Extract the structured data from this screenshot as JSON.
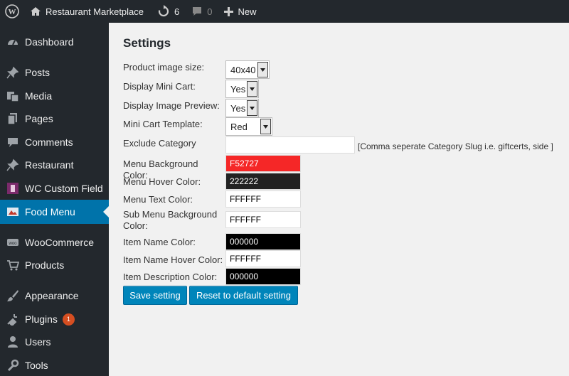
{
  "adminbar": {
    "site_name": "Restaurant Marketplace",
    "updates_count": "6",
    "comments_count": "0",
    "new_label": "New"
  },
  "sidebar": {
    "items": [
      {
        "label": "Dashboard",
        "icon": "dashboard-icon"
      },
      {
        "label": "Posts",
        "icon": "pin-icon"
      },
      {
        "label": "Media",
        "icon": "media-icon"
      },
      {
        "label": "Pages",
        "icon": "pages-icon"
      },
      {
        "label": "Comments",
        "icon": "comments-icon"
      },
      {
        "label": "Restaurant",
        "icon": "pin-icon"
      },
      {
        "label": "WC Custom Field",
        "icon": "plugin-logo-icon"
      },
      {
        "label": "Food Menu",
        "icon": "food-menu-icon",
        "active": true
      },
      {
        "label": "WooCommerce",
        "icon": "woocommerce-icon"
      },
      {
        "label": "Products",
        "icon": "cart-icon"
      },
      {
        "label": "Appearance",
        "icon": "brush-icon"
      },
      {
        "label": "Plugins",
        "icon": "plugins-icon",
        "badge": "1"
      },
      {
        "label": "Users",
        "icon": "users-icon"
      },
      {
        "label": "Tools",
        "icon": "wrench-icon"
      }
    ]
  },
  "settings": {
    "title": "Settings",
    "product_image_size": {
      "label": "Product image size:",
      "value": "40x40"
    },
    "display_mini_cart": {
      "label": "Display Mini Cart:",
      "value": "Yes"
    },
    "display_image_preview": {
      "label": "Display Image Preview:",
      "value": "Yes"
    },
    "mini_cart_template": {
      "label": "Mini Cart Template:",
      "value": "Red"
    },
    "exclude_category": {
      "label": "Exclude Category",
      "value": "",
      "hint": "[Comma seperate Category Slug i.e. giftcerts, side ]"
    },
    "menu_bg_color": {
      "label": "Menu Background Color:",
      "value": "F52727",
      "bg": "#F52727",
      "fg": "#ffffff"
    },
    "menu_hover_color": {
      "label": "Menu Hover Color:",
      "value": "222222",
      "bg": "#222222",
      "fg": "#ffffff"
    },
    "menu_text_color": {
      "label": "Menu Text Color:",
      "value": "FFFFFF",
      "bg": "#FFFFFF",
      "fg": "#000000"
    },
    "sub_menu_bg_color": {
      "label": "Sub Menu Background Color:",
      "value": "FFFFFF",
      "bg": "#FFFFFF",
      "fg": "#000000"
    },
    "item_name_color": {
      "label": "Item Name Color:",
      "value": "000000",
      "bg": "#000000",
      "fg": "#ffffff"
    },
    "item_name_hover_color": {
      "label": "Item Name Hover Color:",
      "value": "FFFFFF",
      "bg": "#FFFFFF",
      "fg": "#000000"
    },
    "item_desc_color": {
      "label": "Item Description Color:",
      "value": "000000",
      "bg": "#000000",
      "fg": "#ffffff"
    },
    "save_label": "Save setting",
    "reset_label": "Reset to default setting"
  },
  "colors": {
    "adminbar": "#23282d",
    "accent": "#0073aa",
    "button": "#0085ba",
    "badge": "#d54e21"
  }
}
